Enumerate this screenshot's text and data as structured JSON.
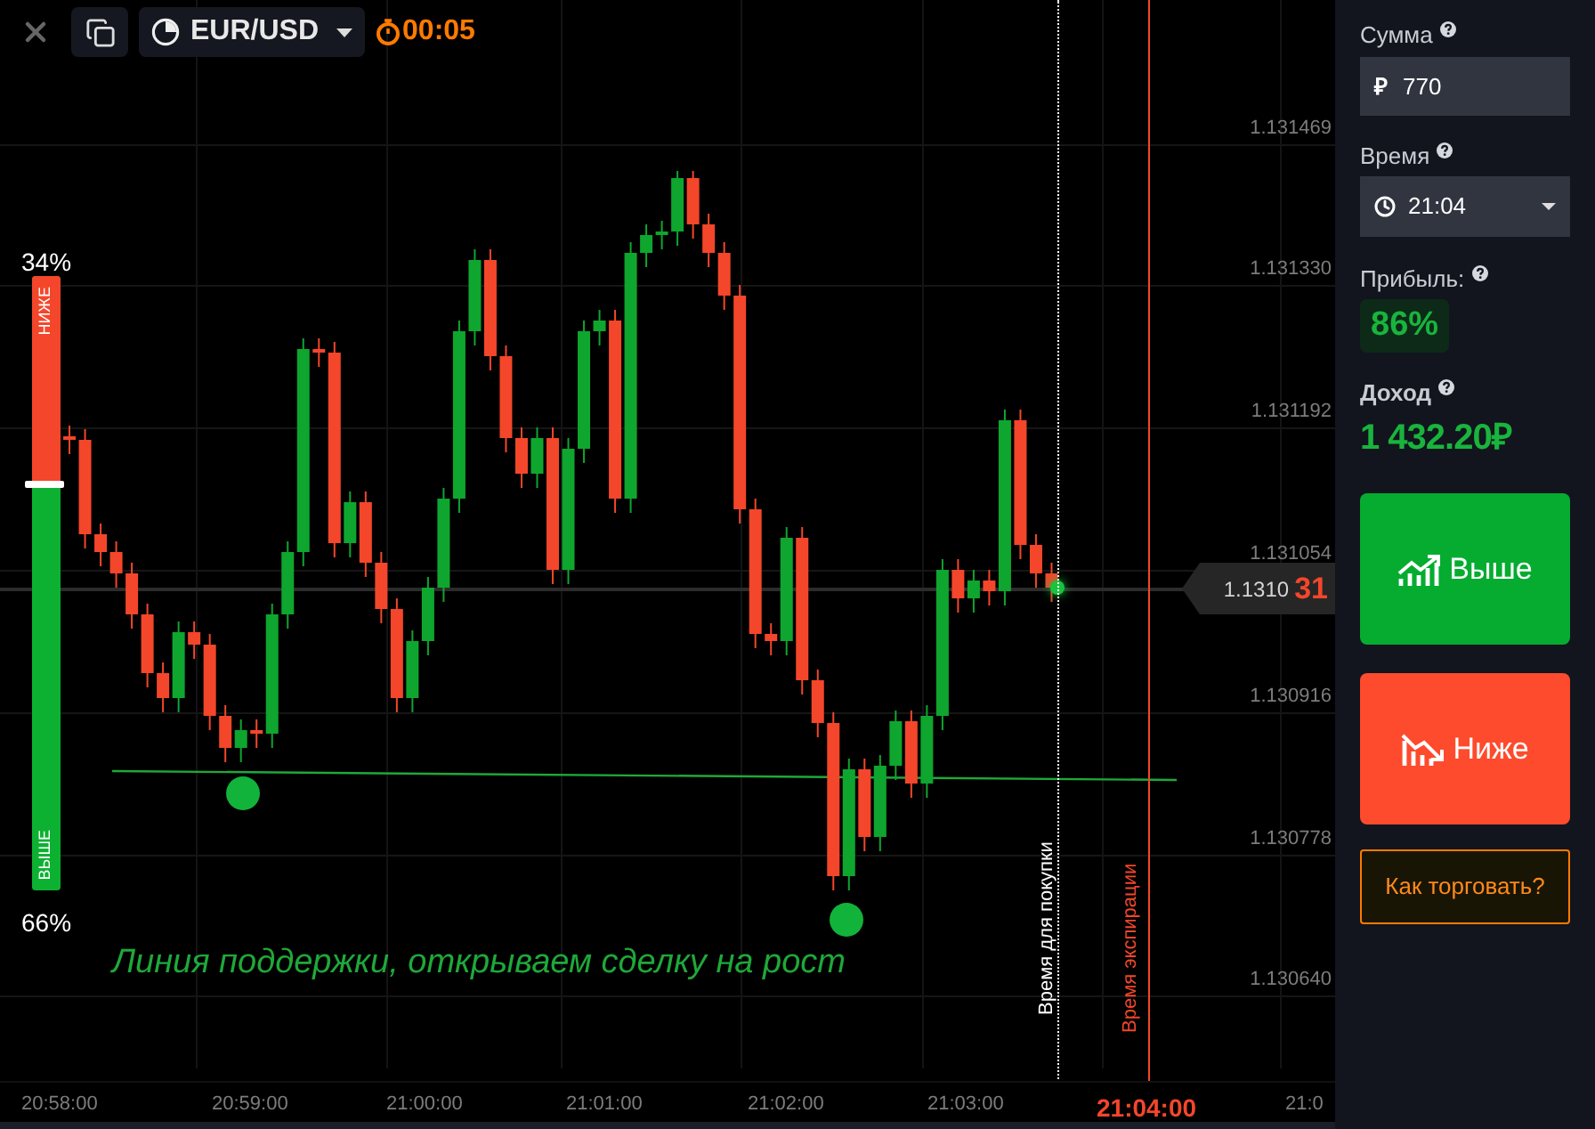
{
  "top_bar": {
    "pair": "EUR/USD",
    "timer": "00:05"
  },
  "sentiment": {
    "down_pct": "34%",
    "down_label": "НИЖЕ",
    "up_label": "ВЫШЕ",
    "up_pct": "66%",
    "level": 0.34
  },
  "price_axis": [
    "1.131469",
    "1.131330",
    "1.131192",
    "1.131054",
    "1.130916",
    "1.130778",
    "1.130640"
  ],
  "current_price": {
    "base": "1.1310",
    "tail": "31"
  },
  "time_axis": [
    {
      "label": "20:58:00",
      "kind": "tick"
    },
    {
      "label": "20:59:00",
      "kind": "tick"
    },
    {
      "label": "21:00:00",
      "kind": "tick"
    },
    {
      "label": "21:01:00",
      "kind": "tick"
    },
    {
      "label": "21:02:00",
      "kind": "tick"
    },
    {
      "label": "21:03:00",
      "kind": "tick"
    },
    {
      "label": "21:04:00",
      "kind": "expiry"
    },
    {
      "label": "21:0",
      "kind": "tick"
    }
  ],
  "purchase_line_label": "Время для покупки",
  "expiry_line_label": "Время экспирации",
  "annotation": "Линия поддержки, открываем сделку на рост",
  "panel": {
    "amount_label": "Сумма",
    "currency_symbol": "₽",
    "amount": "770",
    "time_label": "Время",
    "time": "21:04",
    "profit_label": "Прибыль:",
    "profit": "86%",
    "income_label": "Доход",
    "income": "1 432.20₽",
    "up_button": "Выше",
    "down_button": "Ниже",
    "help_link": "Как торговать?"
  }
}
